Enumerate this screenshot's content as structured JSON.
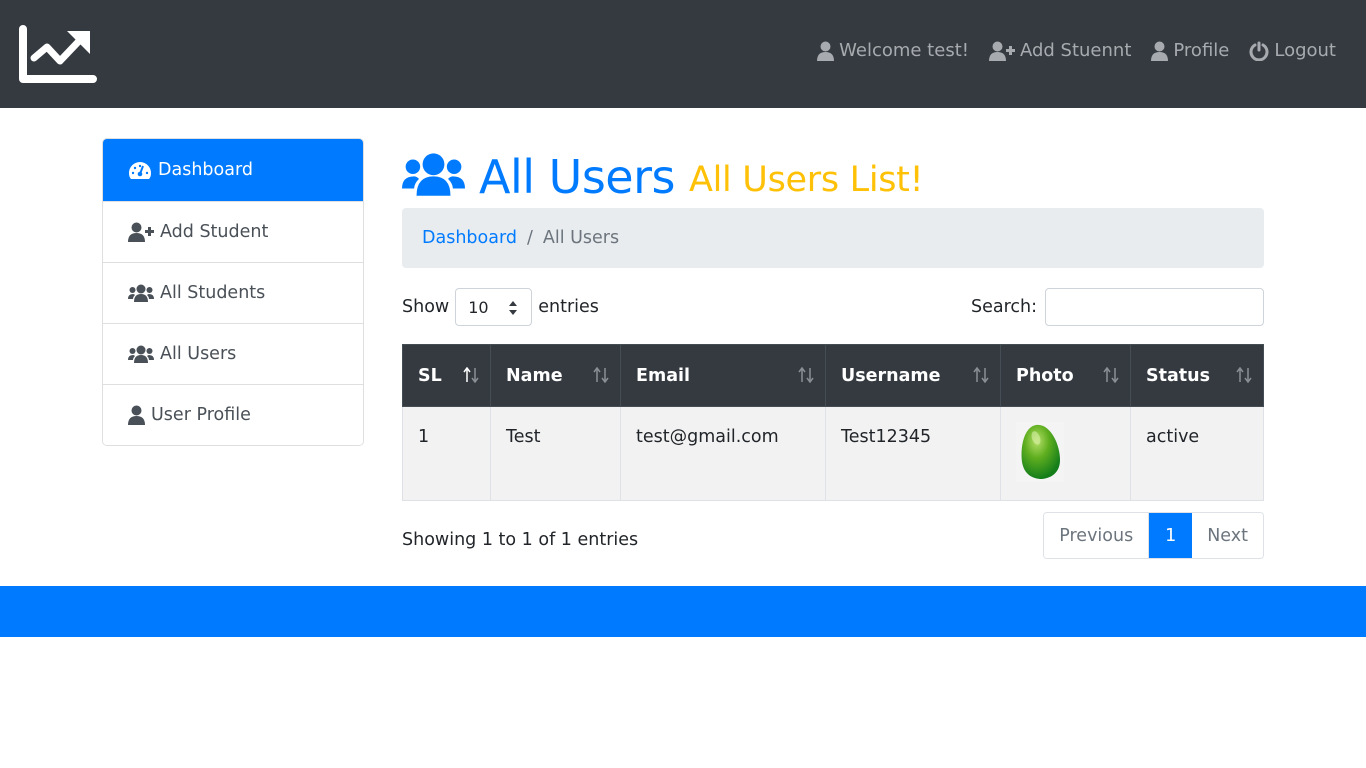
{
  "navbar": {
    "brand_icon": "chart-line-icon",
    "links": [
      {
        "icon": "user-icon",
        "label": "Welcome test!"
      },
      {
        "icon": "user-plus-icon",
        "label": "Add Stuennt"
      },
      {
        "icon": "user-icon",
        "label": "Profile"
      },
      {
        "icon": "power-off-icon",
        "label": "Logout"
      }
    ]
  },
  "sidebar": {
    "items": [
      {
        "icon": "tachometer-icon",
        "label": "Dashboard",
        "active": true
      },
      {
        "icon": "user-plus-icon",
        "label": "Add Student"
      },
      {
        "icon": "users-icon",
        "label": "All Students"
      },
      {
        "icon": "users-icon",
        "label": "All Users"
      },
      {
        "icon": "user-icon",
        "label": "User Profile"
      }
    ]
  },
  "header": {
    "icon": "users-icon",
    "title": "All Users",
    "subtitle": "All Users List!"
  },
  "breadcrumb": {
    "link": "Dashboard",
    "separator": "/",
    "current": "All Users"
  },
  "table_controls": {
    "show_label": "Show",
    "entries_value": "10",
    "entries_label": "entries",
    "search_label": "Search:",
    "search_value": ""
  },
  "table": {
    "columns": [
      "SL",
      "Name",
      "Email",
      "Username",
      "Photo",
      "Status"
    ],
    "rows": [
      {
        "sl": "1",
        "name": "Test",
        "email": "test@gmail.com",
        "username": "Test12345",
        "photo": "green-egg-image",
        "status": "active"
      }
    ]
  },
  "footer_info": {
    "showing": "Showing 1 to 1 of 1 entries",
    "previous": "Previous",
    "page": "1",
    "next": "Next"
  },
  "colors": {
    "navbar": "#343a40",
    "primary": "#007bff",
    "warning": "#ffc107",
    "breadcrumb_bg": "#e9ecef",
    "table_head": "#343a40",
    "row_bg": "#f2f2f2"
  }
}
